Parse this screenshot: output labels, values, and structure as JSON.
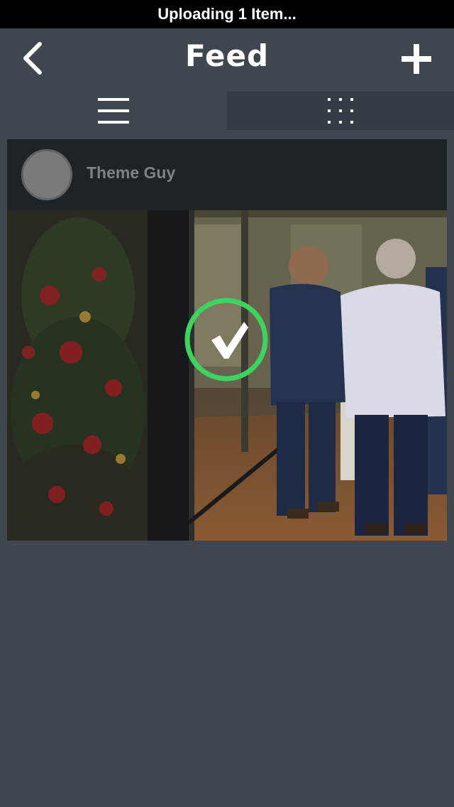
{
  "status_bar": {
    "text": "Uploading 1 Item..."
  },
  "nav": {
    "title": "Feed",
    "back_icon": "chevron-left-icon",
    "add_icon": "plus-icon"
  },
  "view_toggle": {
    "list_icon": "list-view-icon",
    "grid_icon": "grid-view-icon",
    "selected": "list"
  },
  "post": {
    "username": "Theme Guy",
    "upload_status_icon": "checkmark-circle-icon",
    "upload_status": "complete",
    "upload_status_color": "#3ed35f"
  },
  "colors": {
    "background": "#3f464e",
    "card": "#1e2328",
    "grid_toggle_bg": "#343b43",
    "accent_green": "#3ed35f"
  }
}
